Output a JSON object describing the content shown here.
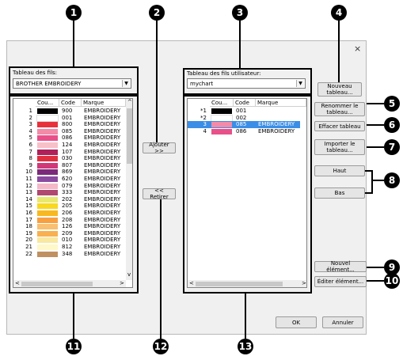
{
  "markers": [
    "1",
    "2",
    "3",
    "4",
    "5",
    "6",
    "7",
    "8",
    "9",
    "10",
    "11",
    "12",
    "13"
  ],
  "dialog": {
    "close_glyph": "×",
    "left_label": "Tableau des fils:",
    "left_select": "BROTHER EMBROIDERY",
    "right_label": "Tableau des fils utilisateur:",
    "right_select": "mychart",
    "dropdown_glyph": "▼",
    "headers": {
      "color": "Cou...",
      "code": "Code",
      "brand": "Marque"
    },
    "add_button": "Ajouter >>",
    "remove_button": "<< Retirer",
    "new_table_button": "Nouveau tableau...",
    "rename_table_button": "Renommer le tableau...",
    "delete_table_button": "Effacer tableau",
    "import_table_button": "Importer le tableau...",
    "up_button": "Haut",
    "down_button": "Bas",
    "new_item_button": "Nouvel élément...",
    "edit_item_button": "Éditer élément...",
    "ok_button": "OK",
    "cancel_button": "Annuler",
    "scroll_left": "<",
    "scroll_right": ">",
    "scroll_up": "^",
    "scroll_down": "v"
  },
  "left_rows": [
    {
      "num": "1",
      "code": "900",
      "brand": "EMBROIDERY",
      "color": "#000000"
    },
    {
      "num": "2",
      "code": "001",
      "brand": "EMBROIDERY",
      "color": "#ffffff"
    },
    {
      "num": "3",
      "code": "800",
      "brand": "EMBROIDERY",
      "color": "#e8303a"
    },
    {
      "num": "4",
      "code": "085",
      "brand": "EMBROIDERY",
      "color": "#f28aa8"
    },
    {
      "num": "5",
      "code": "086",
      "brand": "EMBROIDERY",
      "color": "#e8508a"
    },
    {
      "num": "6",
      "code": "124",
      "brand": "EMBROIDERY",
      "color": "#f8c0c8"
    },
    {
      "num": "7",
      "code": "107",
      "brand": "EMBROIDERY",
      "color": "#b0205a"
    },
    {
      "num": "8",
      "code": "030",
      "brand": "EMBROIDERY",
      "color": "#e03040"
    },
    {
      "num": "9",
      "code": "807",
      "brand": "EMBROIDERY",
      "color": "#d03878"
    },
    {
      "num": "10",
      "code": "869",
      "brand": "EMBROIDERY",
      "color": "#7a2a7a"
    },
    {
      "num": "11",
      "code": "620",
      "brand": "EMBROIDERY",
      "color": "#8a4aa0"
    },
    {
      "num": "12",
      "code": "079",
      "brand": "EMBROIDERY",
      "color": "#f4b8c8"
    },
    {
      "num": "13",
      "code": "333",
      "brand": "EMBROIDERY",
      "color": "#b04870"
    },
    {
      "num": "14",
      "code": "202",
      "brand": "EMBROIDERY",
      "color": "#e8e870"
    },
    {
      "num": "15",
      "code": "205",
      "brand": "EMBROIDERY",
      "color": "#f8d820"
    },
    {
      "num": "16",
      "code": "206",
      "brand": "EMBROIDERY",
      "color": "#f8b820"
    },
    {
      "num": "17",
      "code": "208",
      "brand": "EMBROIDERY",
      "color": "#f8a040"
    },
    {
      "num": "18",
      "code": "126",
      "brand": "EMBROIDERY",
      "color": "#f8c070"
    },
    {
      "num": "19",
      "code": "209",
      "brand": "EMBROIDERY",
      "color": "#f8b050"
    },
    {
      "num": "20",
      "code": "010",
      "brand": "EMBROIDERY",
      "color": "#f8e8a0"
    },
    {
      "num": "21",
      "code": "812",
      "brand": "EMBROIDERY",
      "color": "#fff8c8"
    },
    {
      "num": "22",
      "code": "348",
      "brand": "EMBROIDERY",
      "color": "#c09060"
    }
  ],
  "right_rows": [
    {
      "num": "*1",
      "code": "001",
      "brand": "",
      "color": "#000000",
      "selected": false
    },
    {
      "num": "*2",
      "code": "002",
      "brand": "",
      "color": "#ffffff",
      "selected": false
    },
    {
      "num": "3",
      "code": "085",
      "brand": "EMBROIDERY",
      "color": "#f28aa8",
      "selected": true
    },
    {
      "num": "4",
      "code": "086",
      "brand": "EMBROIDERY",
      "color": "#e8508a",
      "selected": false
    }
  ]
}
